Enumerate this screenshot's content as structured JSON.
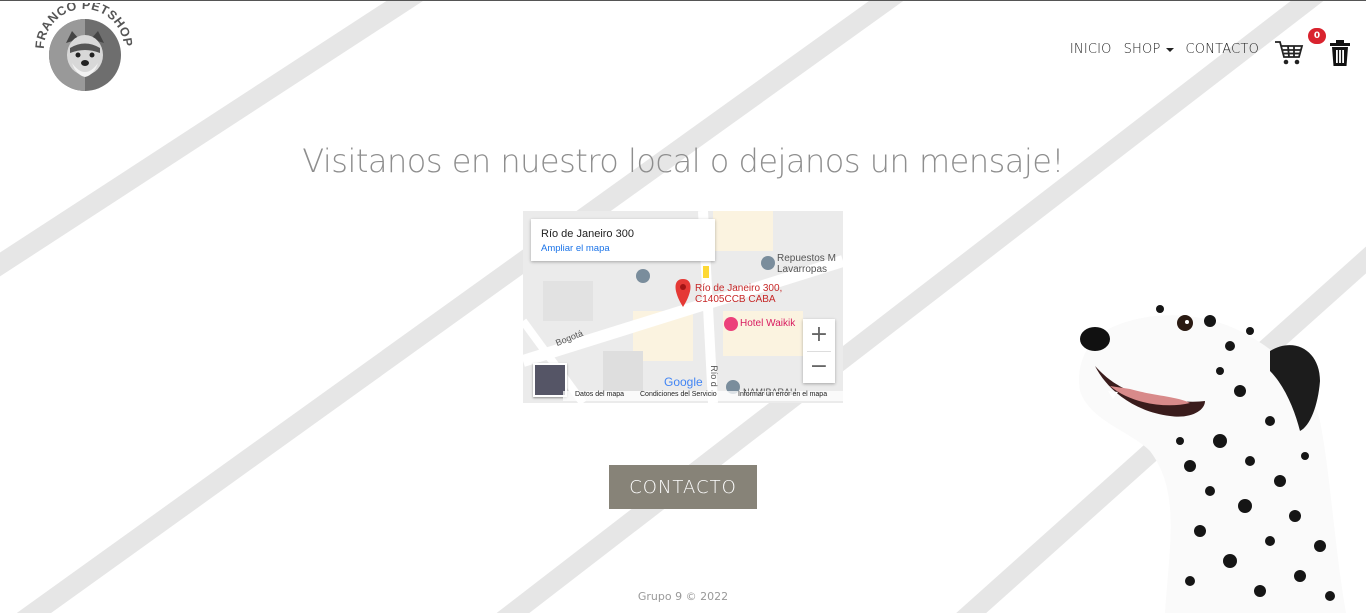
{
  "brand": {
    "logo_text": "FRANCO PETSHOP"
  },
  "nav": {
    "inicio": "INICIO",
    "shop": "SHOP",
    "contacto": "CONTACTO"
  },
  "cart": {
    "count": "0"
  },
  "main": {
    "title": "Visitanos en nuestro local o dejanos un mensaje!"
  },
  "map": {
    "address": "Río de Janeiro 300",
    "expand_link": "Ampliar el mapa",
    "pin_label_line1": "Río de Janeiro 300,",
    "pin_label_line2": "C1405CCB CABA",
    "poi_repuestos": "Repuestos M",
    "poi_lavarropas": "Lavarropas",
    "poi_hotel": "Hotel Waikik",
    "street_bogota": "Bogotá",
    "street_rio": "Río d",
    "poi_namibarah": "NAMIBARAH",
    "google": "Google",
    "footer_datos": "Datos del mapa",
    "footer_condiciones": "Condiciones del Servicio",
    "footer_error": "Informar un error en el mapa"
  },
  "contact_button": "CONTACTO",
  "footer": {
    "text": "Grupo 9 © 2022"
  },
  "colors": {
    "button": "#878378",
    "badge": "#d9232e",
    "title": "#8e8e8e",
    "pin": "#e53935"
  }
}
